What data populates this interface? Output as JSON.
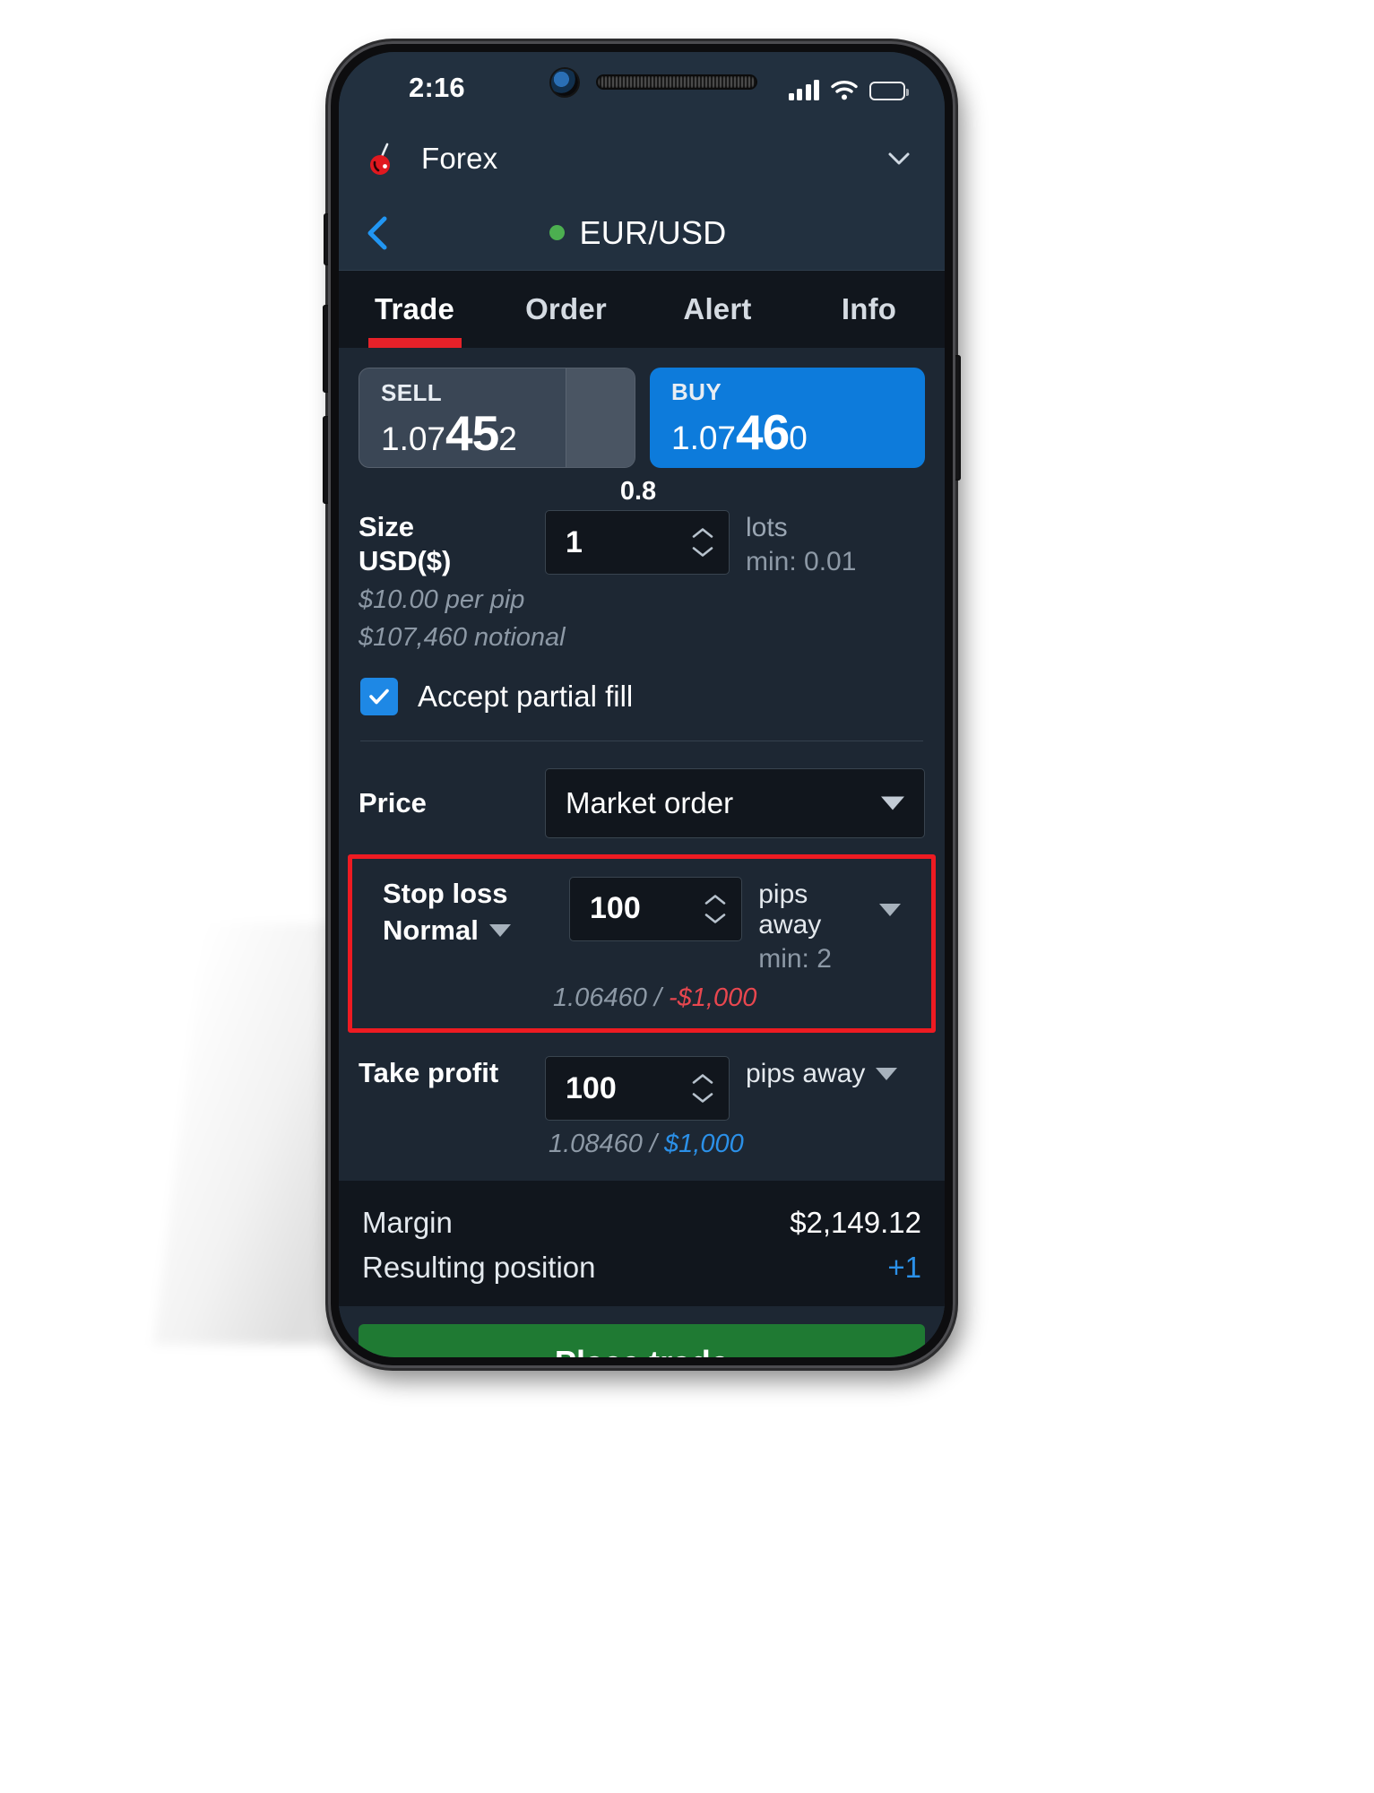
{
  "status_bar": {
    "time": "2:16",
    "signal_icon": "cellular-bars-icon",
    "wifi_icon": "wifi-icon",
    "battery_icon": "battery-icon"
  },
  "app_header": {
    "logo_icon": "cherry-logo-icon",
    "title": "Forex",
    "expand_icon": "chevron-down-icon"
  },
  "nav": {
    "back_icon": "back-chevron-icon",
    "status_dot": "market-open-dot",
    "instrument": "EUR/USD"
  },
  "tabs": [
    {
      "label": "Trade",
      "active": true
    },
    {
      "label": "Order",
      "active": false
    },
    {
      "label": "Alert",
      "active": false
    },
    {
      "label": "Info",
      "active": false
    }
  ],
  "quote": {
    "sell": {
      "label": "SELL",
      "prefix": "1.07",
      "big": "45",
      "tail": "2",
      "full": "1.07452"
    },
    "buy": {
      "label": "BUY",
      "prefix": "1.07",
      "big": "46",
      "tail": "0",
      "full": "1.07460"
    },
    "spread": "0.8"
  },
  "size": {
    "label": "Size",
    "currency": "USD($)",
    "value": "1",
    "unit": "lots",
    "min": "min: 0.01",
    "per_pip": "$10.00 per pip",
    "notional": "$107,460 notional"
  },
  "partial_fill": {
    "label": "Accept partial fill",
    "checked": true,
    "check_icon": "checkmark-icon"
  },
  "price": {
    "label": "Price",
    "selected": "Market order",
    "caret_icon": "caret-down-icon"
  },
  "stop_loss": {
    "label": "Stop loss",
    "type": "Normal",
    "type_caret_icon": "caret-down-icon",
    "value": "100",
    "unit": "pips away",
    "unit_caret_icon": "caret-down-icon",
    "min": "min: 2",
    "level": "1.06460",
    "separator": " / ",
    "amount": "-$1,000",
    "highlighted": true,
    "highlight_color": "#ee1b22"
  },
  "take_profit": {
    "label": "Take profit",
    "value": "100",
    "unit": "pips away",
    "unit_caret_icon": "caret-down-icon",
    "level": "1.08460",
    "separator": " / ",
    "amount": "$1,000"
  },
  "summary": {
    "margin_label": "Margin",
    "margin_value": "$2,149.12",
    "position_label": "Resulting position",
    "position_value": "+1"
  },
  "cta": {
    "label": "Place trade"
  },
  "colors": {
    "buy": "#0d7bdb",
    "sell": "#3a4655",
    "accent_red": "#e62129",
    "place_trade_green": "#1f7a33",
    "link_blue": "#2b90e8",
    "loss_red": "#e8474f",
    "background": "#1d2733"
  }
}
